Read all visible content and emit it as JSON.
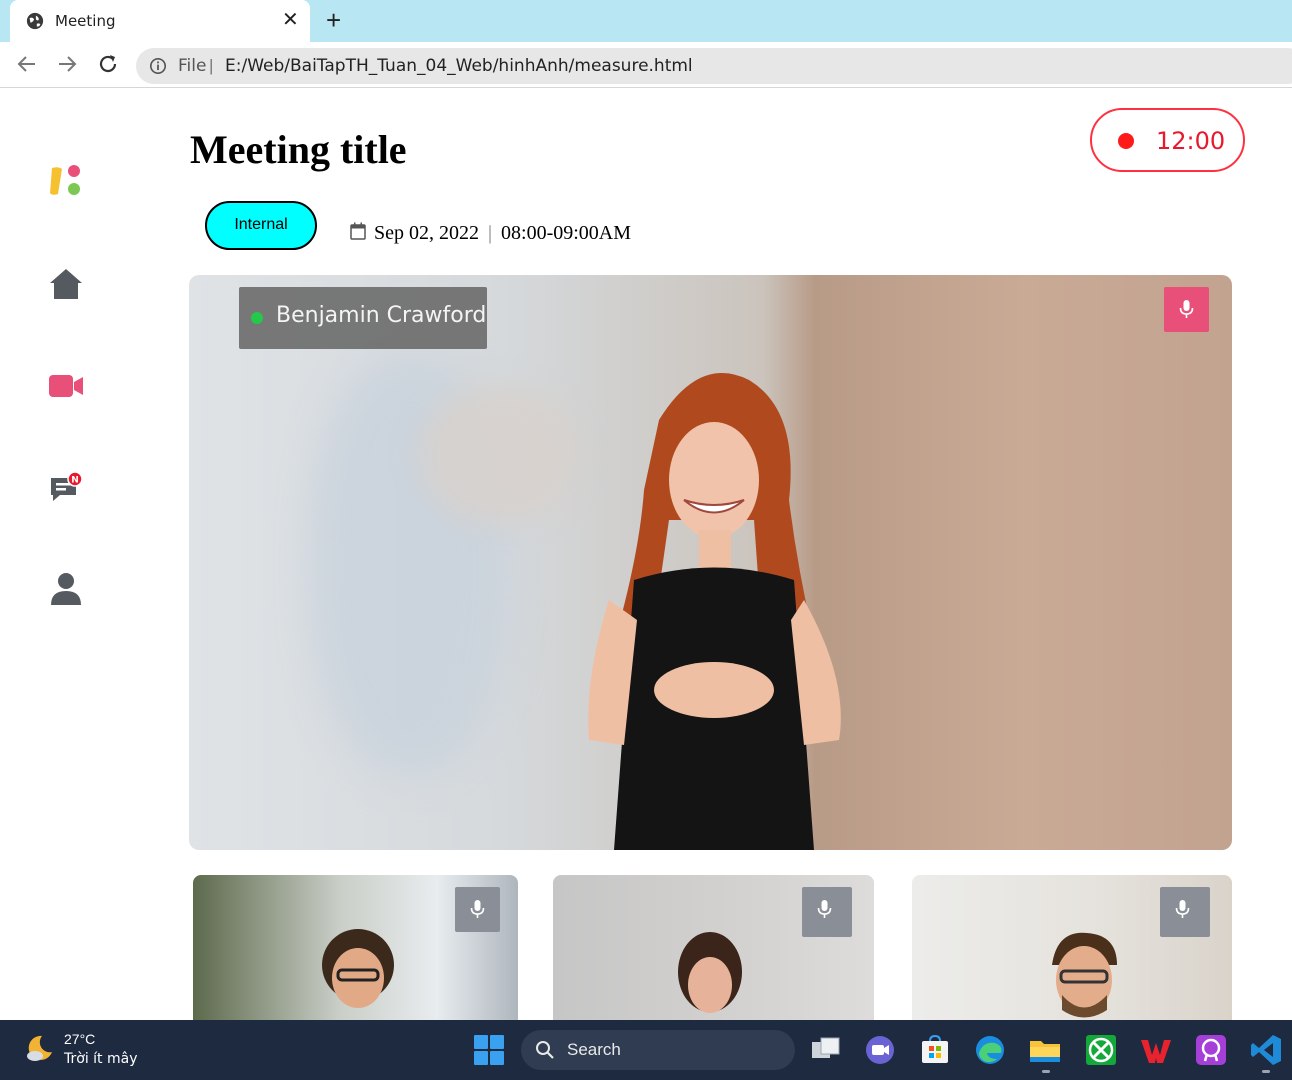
{
  "browser": {
    "tab_title": "Meeting",
    "tab_close": "✕",
    "new_tab": "+",
    "file_label": "File",
    "url_separator": "|",
    "url": "E:/Web/BaiTapTH_Tuan_04_Web/hinhAnh/measure.html"
  },
  "sidebar": {
    "items": [
      {
        "icon": "logo-icon"
      },
      {
        "icon": "home-icon"
      },
      {
        "icon": "video-camera-icon"
      },
      {
        "icon": "chat-icon",
        "badge": "N"
      },
      {
        "icon": "user-icon"
      }
    ]
  },
  "meeting": {
    "title": "Meeting title",
    "timer": "12:00",
    "tag": "Internal",
    "date": "Sep 02, 2022",
    "separator": "|",
    "time": "08:00-09:00AM"
  },
  "main_video": {
    "participant_name": "Benjamin Crawford",
    "status": "online",
    "mic_icon": "microphone-icon"
  },
  "thumbnails": [
    {
      "mic_icon": "microphone-icon"
    },
    {
      "mic_icon": "microphone-icon"
    },
    {
      "mic_icon": "microphone-icon"
    }
  ],
  "taskbar": {
    "temperature": "27°C",
    "weather_desc": "Trời ít mây",
    "search_label": "Search",
    "apps": [
      "task-view",
      "teams-chat",
      "microsoft-store",
      "edge",
      "file-explorer",
      "xbox",
      "wps-office",
      "git-app",
      "vscode"
    ]
  },
  "colors": {
    "accent_pink": "#e8507a",
    "timer_red": "#e8192c",
    "tag_cyan": "#00ffff",
    "online_green": "#22c94a",
    "icon_gray": "#555a60"
  }
}
